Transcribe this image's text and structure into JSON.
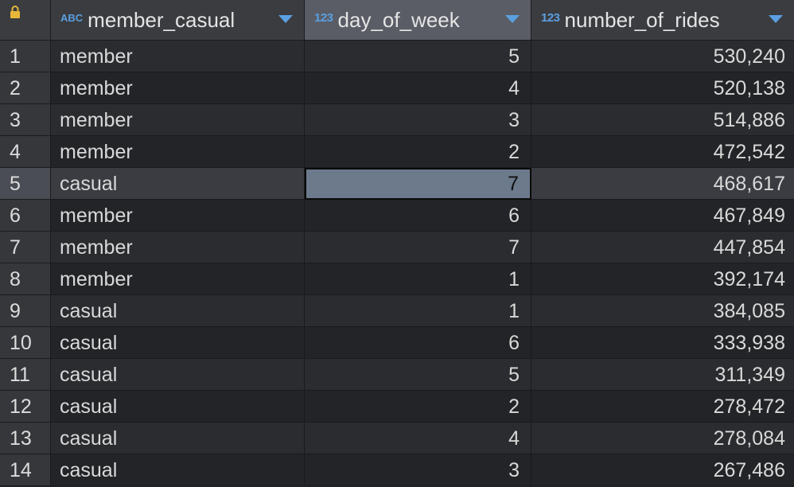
{
  "columns": [
    {
      "type_icon": "ABC",
      "label": "member_casual"
    },
    {
      "type_icon": "123",
      "label": "day_of_week"
    },
    {
      "type_icon": "123",
      "label": "number_of_rides"
    }
  ],
  "rows": [
    {
      "num": "1",
      "member_casual": "member",
      "day_of_week": "5",
      "number_of_rides": "530,240"
    },
    {
      "num": "2",
      "member_casual": "member",
      "day_of_week": "4",
      "number_of_rides": "520,138"
    },
    {
      "num": "3",
      "member_casual": "member",
      "day_of_week": "3",
      "number_of_rides": "514,886"
    },
    {
      "num": "4",
      "member_casual": "member",
      "day_of_week": "2",
      "number_of_rides": "472,542"
    },
    {
      "num": "5",
      "member_casual": "casual",
      "day_of_week": "7",
      "number_of_rides": "468,617"
    },
    {
      "num": "6",
      "member_casual": "member",
      "day_of_week": "6",
      "number_of_rides": "467,849"
    },
    {
      "num": "7",
      "member_casual": "member",
      "day_of_week": "7",
      "number_of_rides": "447,854"
    },
    {
      "num": "8",
      "member_casual": "member",
      "day_of_week": "1",
      "number_of_rides": "392,174"
    },
    {
      "num": "9",
      "member_casual": "casual",
      "day_of_week": "1",
      "number_of_rides": "384,085"
    },
    {
      "num": "10",
      "member_casual": "casual",
      "day_of_week": "6",
      "number_of_rides": "333,938"
    },
    {
      "num": "11",
      "member_casual": "casual",
      "day_of_week": "5",
      "number_of_rides": "311,349"
    },
    {
      "num": "12",
      "member_casual": "casual",
      "day_of_week": "2",
      "number_of_rides": "278,472"
    },
    {
      "num": "13",
      "member_casual": "casual",
      "day_of_week": "4",
      "number_of_rides": "278,084"
    },
    {
      "num": "14",
      "member_casual": "casual",
      "day_of_week": "3",
      "number_of_rides": "267,486"
    }
  ],
  "selected_row": "5",
  "selected_column": "day_of_week",
  "icons": {
    "corner": "lock-icon",
    "sort": "chevron-down-icon"
  },
  "colors": {
    "type_icon": "#5b9fe0",
    "lock": "#e8b73a",
    "selected_cell": "#6c7a8c"
  }
}
